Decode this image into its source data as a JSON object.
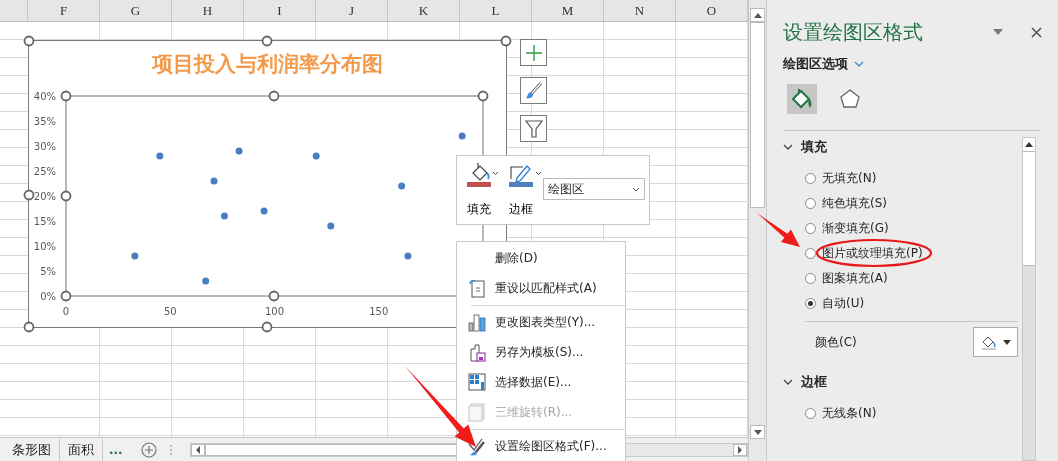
{
  "column_headers": [
    "F",
    "G",
    "H",
    "I",
    "J",
    "K",
    "L",
    "M",
    "N",
    "O"
  ],
  "chart": {
    "title": "项目投入与利润率分布图",
    "chart_data": {
      "type": "scatter",
      "xlim": [
        0,
        200
      ],
      "ylim": [
        0,
        0.4
      ],
      "xticks": [
        0,
        50,
        100,
        150
      ],
      "yticks": [
        {
          "value": 0,
          "label": "0%"
        },
        {
          "value": 0.05,
          "label": "5%"
        },
        {
          "value": 0.1,
          "label": "10%"
        },
        {
          "value": 0.15,
          "label": "15%"
        },
        {
          "value": 0.2,
          "label": "20%"
        },
        {
          "value": 0.25,
          "label": "25%"
        },
        {
          "value": 0.3,
          "label": "30%"
        },
        {
          "value": 0.35,
          "label": "35%"
        },
        {
          "value": 0.4,
          "label": "40%"
        }
      ],
      "x": [
        45,
        71,
        83,
        76,
        95,
        120,
        127,
        33,
        67,
        161,
        164,
        190
      ],
      "series": [
        {
          "color": "#4a7dbf",
          "values": [
            0.28,
            0.23,
            0.29,
            0.16,
            0.17,
            0.28,
            0.14,
            0.08,
            0.03,
            0.22,
            0.08,
            0.32
          ]
        }
      ]
    }
  },
  "chart_tools": [
    {
      "kind": "add"
    },
    {
      "kind": "style"
    },
    {
      "kind": "filter"
    }
  ],
  "mini_toolbar": {
    "buttons": [
      {
        "kind": "fill",
        "label": "填充",
        "color": "#c0504d"
      },
      {
        "kind": "border",
        "label": "边框",
        "color": "#4f81bd"
      }
    ],
    "element_select": "绘图区"
  },
  "context_menu": [
    {
      "kind": "delete",
      "label": "删除(D)",
      "disabled": false
    },
    {
      "kind": "reset",
      "label": "重设以匹配样式(A)",
      "disabled": false
    },
    {
      "kind": "separator"
    },
    {
      "kind": "chart",
      "label": "更改图表类型(Y)...",
      "disabled": false
    },
    {
      "kind": "template",
      "label": "另存为模板(S)...",
      "disabled": false
    },
    {
      "kind": "data",
      "label": "选择数据(E)...",
      "disabled": false
    },
    {
      "kind": "rotate",
      "label": "三维旋转(R)...",
      "disabled": true
    },
    {
      "kind": "separator"
    },
    {
      "kind": "format",
      "label": "设置绘图区格式(F)...",
      "disabled": false
    }
  ],
  "sheet_tabs": [
    {
      "label": "条形图",
      "selected": false
    },
    {
      "label": "面积",
      "selected": false
    }
  ],
  "more_tabs": "...",
  "task_pane": {
    "title": "设置绘图区格式",
    "options_label": "绘图区选项",
    "icon_tabs": [
      {
        "kind": "fill",
        "selected": true
      },
      {
        "kind": "effects",
        "selected": false
      }
    ],
    "sections": [
      {
        "kind": "fill",
        "label": "填充",
        "expanded": true,
        "options": [
          {
            "label": "无填充(N)",
            "selected": false
          },
          {
            "label": "纯色填充(S)",
            "selected": false
          },
          {
            "label": "渐变填充(G)",
            "selected": false
          },
          {
            "label": "图片或纹理填充(P)",
            "selected": false
          },
          {
            "label": "图案填充(A)",
            "selected": false
          },
          {
            "label": "自动(U)",
            "selected": true
          }
        ],
        "color_label": "颜色(C)"
      },
      {
        "kind": "border",
        "label": "边框",
        "expanded": true,
        "options": [
          {
            "label": "无线条(N)",
            "selected": false
          }
        ]
      }
    ]
  }
}
